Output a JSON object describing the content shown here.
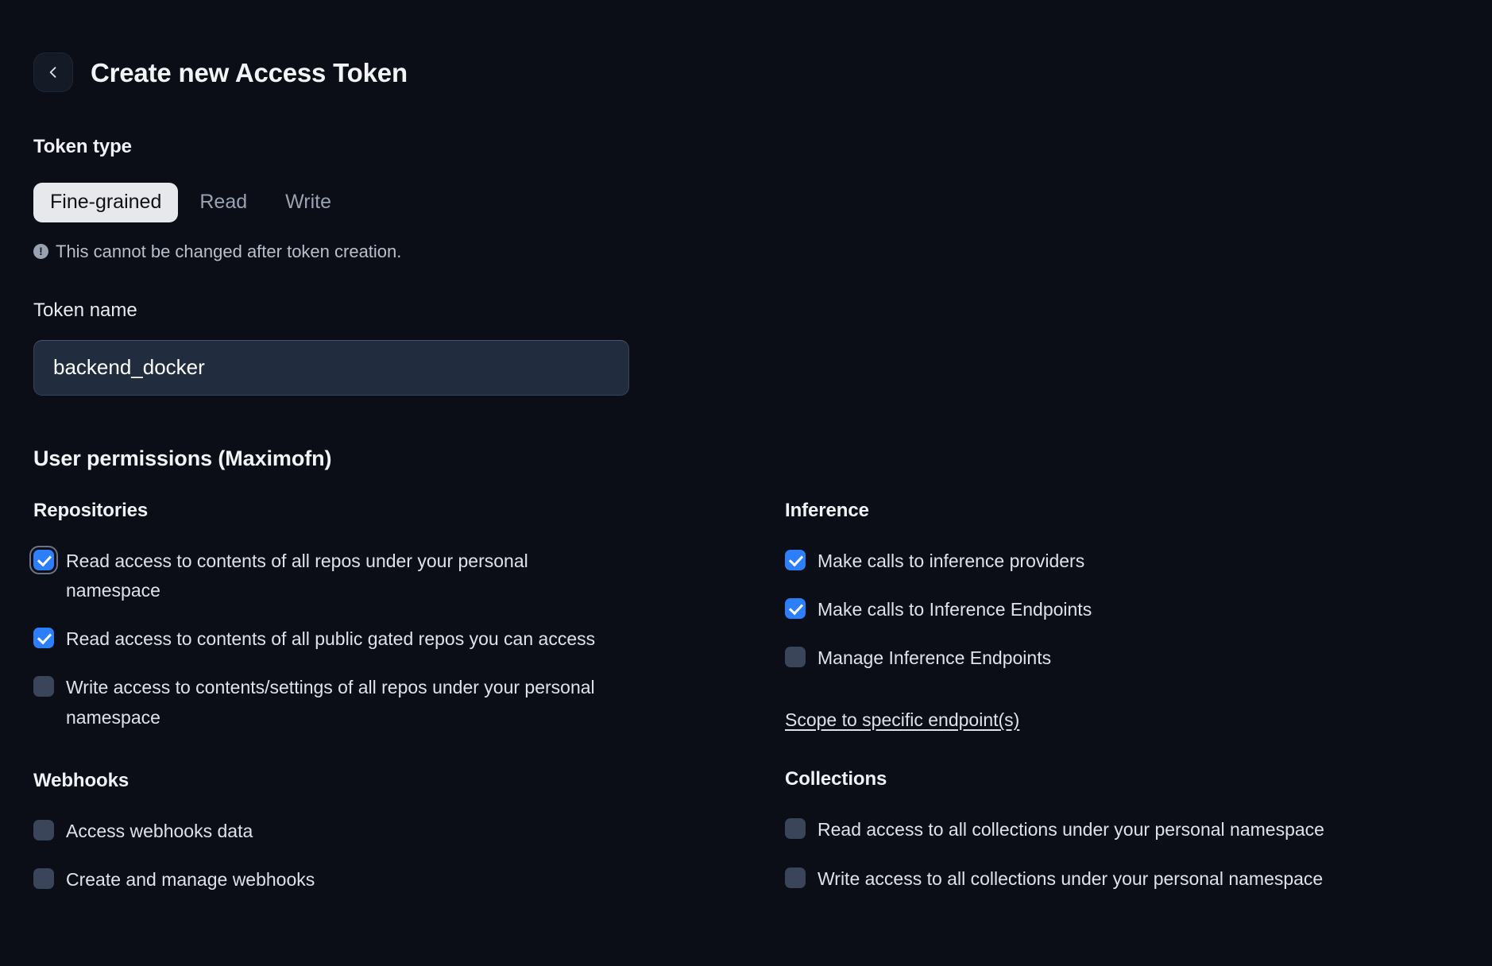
{
  "header": {
    "back_icon": "chevron-left-icon",
    "title": "Create new Access Token"
  },
  "token_type": {
    "label": "Token type",
    "tabs": [
      {
        "label": "Fine-grained",
        "active": true
      },
      {
        "label": "Read",
        "active": false
      },
      {
        "label": "Write",
        "active": false
      }
    ],
    "hint_icon": "warning-icon",
    "hint": "This cannot be changed after token creation."
  },
  "token_name": {
    "label": "Token name",
    "value": "backend_docker",
    "placeholder": ""
  },
  "permissions": {
    "title": "User permissions (Maximofn)",
    "left_groups": [
      {
        "title": "Repositories",
        "items": [
          {
            "label": "Read access to contents of all repos under your personal namespace",
            "checked": true,
            "focused": true
          },
          {
            "label": "Read access to contents of all public gated repos you can access",
            "checked": true,
            "focused": false
          },
          {
            "label": "Write access to contents/settings of all repos under your personal namespace",
            "checked": false,
            "focused": false
          }
        ]
      },
      {
        "title": "Webhooks",
        "items": [
          {
            "label": "Access webhooks data",
            "checked": false,
            "focused": false
          },
          {
            "label": "Create and manage webhooks",
            "checked": false,
            "focused": false
          }
        ]
      }
    ],
    "right_groups": [
      {
        "title": "Inference",
        "items": [
          {
            "label": "Make calls to inference providers",
            "checked": true,
            "focused": false
          },
          {
            "label": "Make calls to Inference Endpoints",
            "checked": true,
            "focused": false
          },
          {
            "label": "Manage Inference Endpoints",
            "checked": false,
            "focused": false
          }
        ],
        "link": "Scope to specific endpoint(s)"
      },
      {
        "title": "Collections",
        "items": [
          {
            "label": "Read access to all collections under your personal namespace",
            "checked": false,
            "focused": false
          },
          {
            "label": "Write access to all collections under your personal namespace",
            "checked": false,
            "focused": false
          }
        ]
      }
    ]
  },
  "colors": {
    "background": "#0b0e17",
    "accent_checked": "#2d7ff9",
    "checkbox_unchecked": "#3b4559",
    "active_tab_bg": "#e7e8ec",
    "input_bg": "#222c3f"
  }
}
